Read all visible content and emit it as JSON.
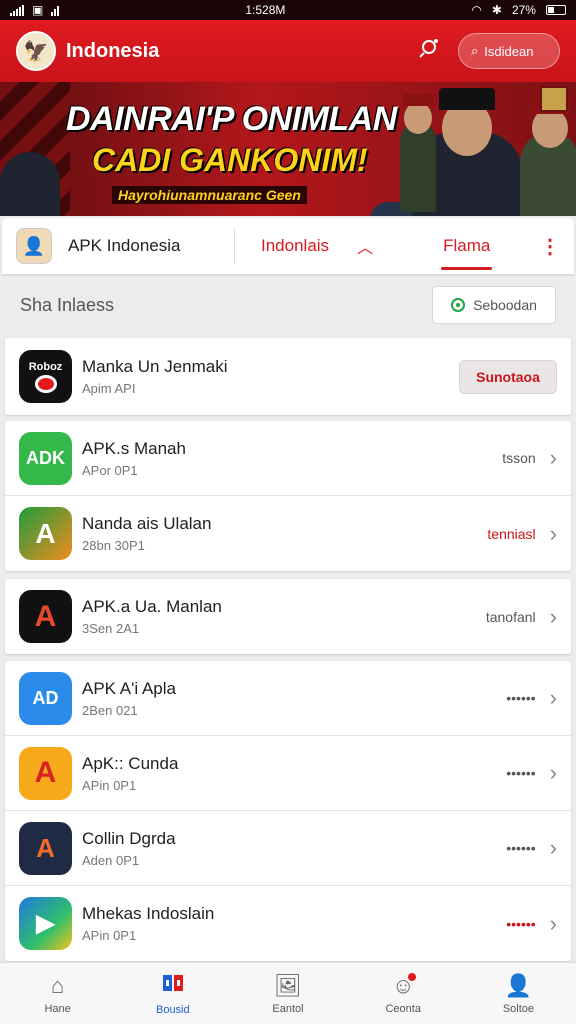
{
  "status_bar": {
    "time": "1:528M",
    "battery": "27%"
  },
  "header": {
    "title": "Indonesia",
    "search_label": "Isdidean"
  },
  "banner": {
    "line1": "DAINRAI'P ONIMLAN",
    "line2": "CADI GANKONIM!",
    "line3": "Hayrohiunamnuaranc Geen"
  },
  "tabs": {
    "brand": "APK Indonesia",
    "items": [
      {
        "label": "Indonlais"
      },
      {
        "label": "Flama"
      }
    ]
  },
  "section": {
    "title": "Sha Inlaess",
    "select_label": "Seboodan"
  },
  "featured": {
    "name": "Manka Un Jenmaki",
    "sub": "Apim API",
    "icon_text": "Roboz",
    "action": "Sunotaoa"
  },
  "apps": [
    {
      "name": "APK.s Manah",
      "sub": "APor 0P1",
      "status": "tsson",
      "icon_text": "ADK",
      "status_red": false
    },
    {
      "name": "Nanda ais Ulalan",
      "sub": "28bn 30P1",
      "status": "tenniasl",
      "icon_text": "A",
      "status_red": true
    },
    {
      "name": "APK.a Ua. Manlan",
      "sub": "3Sen 2A1",
      "status": "tanofanl",
      "icon_text": "A",
      "status_red": false
    },
    {
      "name": "APK A'i Apla",
      "sub": "2Ben 021",
      "status": "••••••",
      "icon_text": "AD",
      "status_red": false
    },
    {
      "name": "ApK:: Cunda",
      "sub": "APin 0P1",
      "status": "••••••",
      "icon_text": "A",
      "status_red": false
    },
    {
      "name": "Collin Dgrda",
      "sub": "Aden 0P1",
      "status": "••••••",
      "icon_text": "A",
      "status_red": false
    },
    {
      "name": "Mhekas Indoslain",
      "sub": "APin 0P1",
      "status": "••••••",
      "icon_text": "▶",
      "status_red": true
    }
  ],
  "nav": [
    {
      "label": "Hane",
      "icon": "home-icon"
    },
    {
      "label": "Bousid",
      "icon": "apps-icon"
    },
    {
      "label": "Eantol",
      "icon": "gallery-icon"
    },
    {
      "label": "Ceonta",
      "icon": "smile-icon"
    },
    {
      "label": "Soltoe",
      "icon": "profile-icon"
    }
  ],
  "colors": {
    "brand_red": "#d81b22",
    "active_blue": "#1f5fd6",
    "green": "#21a546"
  }
}
